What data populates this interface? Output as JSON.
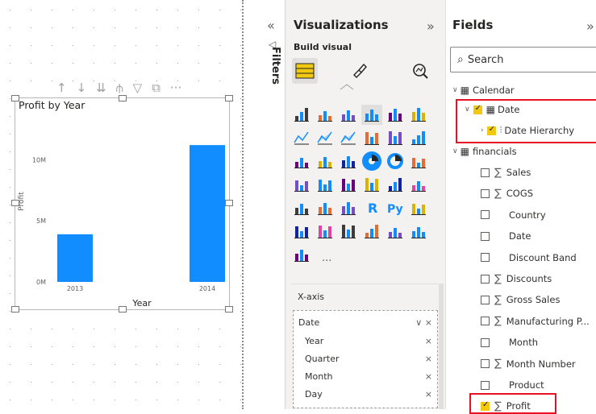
{
  "visual": {
    "title": "Profit by Year",
    "toolbar_icons": [
      "arrow-up-icon",
      "arrow-down-icon",
      "double-arrow-down-icon",
      "expand-hierarchy-icon",
      "filter-icon",
      "focus-mode-icon",
      "more-options-icon"
    ],
    "more_label": "···"
  },
  "chart_data": {
    "type": "bar",
    "title": "Profit by Year",
    "xlabel": "Year",
    "ylabel": "Profit",
    "categories": [
      "2013",
      "2014"
    ],
    "values": [
      3.9,
      11.2
    ],
    "yticks": [
      "0M",
      "5M",
      "10M"
    ],
    "ylim": [
      0,
      12
    ],
    "color": "#118dff",
    "grid": false
  },
  "filters": {
    "label": "Filters",
    "collapse_glyph": "«",
    "icon": "filter-funnel-icon"
  },
  "visualizations": {
    "title": "Visualizations",
    "expand_glyph": "»",
    "build_visual": "Build visual",
    "tabs": [
      "build-visual-tab",
      "format-visual-tab",
      "analytics-tab"
    ],
    "more_label": "···",
    "xaxis_label": "X-axis",
    "well": {
      "field": "Date",
      "items": [
        "Year",
        "Quarter",
        "Month",
        "Day"
      ],
      "remove_glyph": "×",
      "chevron": "∨"
    }
  },
  "fields": {
    "title": "Fields",
    "expand_glyph": "»",
    "search_placeholder": "Search",
    "calendar": {
      "table": "Calendar",
      "date": "Date",
      "date_hierarchy": "Date Hierarchy"
    },
    "financials": {
      "table": "financials",
      "items": [
        {
          "label": "Sales",
          "sigma": true,
          "checked": false
        },
        {
          "label": "COGS",
          "sigma": true,
          "checked": false
        },
        {
          "label": "Country",
          "sigma": false,
          "checked": false
        },
        {
          "label": "Date",
          "sigma": false,
          "checked": false
        },
        {
          "label": "Discount Band",
          "sigma": false,
          "checked": false
        },
        {
          "label": "Discounts",
          "sigma": true,
          "checked": false
        },
        {
          "label": "Gross Sales",
          "sigma": true,
          "checked": false
        },
        {
          "label": "Manufacturing P...",
          "sigma": true,
          "checked": false
        },
        {
          "label": "Month",
          "sigma": false,
          "checked": false
        },
        {
          "label": "Month Number",
          "sigma": true,
          "checked": false
        },
        {
          "label": "Product",
          "sigma": false,
          "checked": false
        },
        {
          "label": "Profit",
          "sigma": true,
          "checked": true
        }
      ]
    },
    "sigma_glyph": "∑"
  },
  "colors": {
    "accent_yellow": "#f2c811",
    "highlight_red": "#e81123",
    "bar_blue": "#118dff"
  }
}
